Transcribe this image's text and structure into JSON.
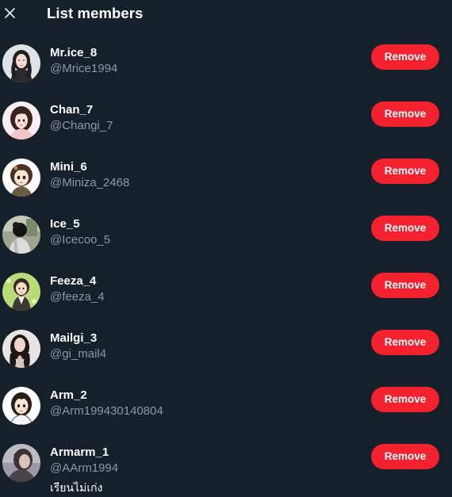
{
  "header": {
    "title": "List members",
    "close_icon": "close-icon"
  },
  "colors": {
    "background": "#15202b",
    "remove_button": "#f4212e",
    "handle_text": "#8b98a5"
  },
  "members": [
    {
      "name": "Mr.ice_8",
      "handle": "@Mrice1994",
      "bio": "",
      "button": "Remove",
      "avatar_icon": "avatar-image"
    },
    {
      "name": "Chan_7",
      "handle": "@Changi_7",
      "bio": "",
      "button": "Remove",
      "avatar_icon": "avatar-image"
    },
    {
      "name": "Mini_6",
      "handle": "@Miniza_2468",
      "bio": "",
      "button": "Remove",
      "avatar_icon": "avatar-image"
    },
    {
      "name": "Ice_5",
      "handle": "@Icecoo_5",
      "bio": "",
      "button": "Remove",
      "avatar_icon": "avatar-image"
    },
    {
      "name": "Feeza_4",
      "handle": "@feeza_4",
      "bio": "",
      "button": "Remove",
      "avatar_icon": "avatar-image"
    },
    {
      "name": "Mailgi_3",
      "handle": "@gi_mail4",
      "bio": "",
      "button": "Remove",
      "avatar_icon": "avatar-image"
    },
    {
      "name": "Arm_2",
      "handle": "@Arm199430140804",
      "bio": "",
      "button": "Remove",
      "avatar_icon": "avatar-image"
    },
    {
      "name": "Armarm_1",
      "handle": "@AArm1994",
      "bio": "เรียนไม่เก่ง",
      "button": "Remove",
      "avatar_icon": "avatar-image"
    }
  ]
}
